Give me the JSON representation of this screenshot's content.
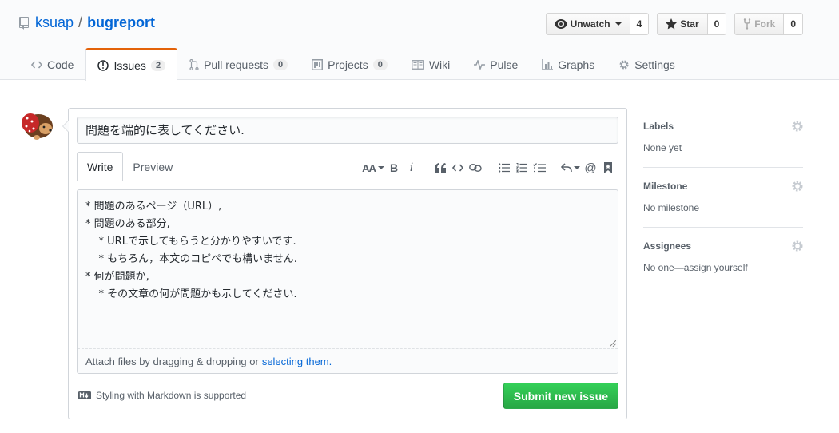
{
  "repo": {
    "owner": "ksuap",
    "separator": "/",
    "name": "bugreport"
  },
  "actions": {
    "watch": {
      "label": "Unwatch",
      "count": "4"
    },
    "star": {
      "label": "Star",
      "count": "0"
    },
    "fork": {
      "label": "Fork",
      "count": "0"
    }
  },
  "tabs": [
    {
      "label": "Code"
    },
    {
      "label": "Issues",
      "count": "2",
      "selected": true
    },
    {
      "label": "Pull requests",
      "count": "0"
    },
    {
      "label": "Projects",
      "count": "0"
    },
    {
      "label": "Wiki"
    },
    {
      "label": "Pulse"
    },
    {
      "label": "Graphs"
    },
    {
      "label": "Settings"
    }
  ],
  "issue_form": {
    "title_value": "問題を端的に表してください.",
    "editor_tabs": {
      "write": "Write",
      "preview": "Preview"
    },
    "toolbar": {
      "text_size": "AA",
      "bold": "B",
      "italic": "i"
    },
    "body_value": "* 問題のあるページ（URL）,\n* 問題のある部分,\n    * URLで示してもらうと分かりやすいです.\n    * もちろん，本文のコピペでも構いません.\n* 何が問題か,\n    * その文章の何が問題かも示してください.",
    "attach_text": "Attach files by dragging & dropping or",
    "attach_link": "selecting them.",
    "markdown_note": "Styling with Markdown is supported",
    "submit_label": "Submit new issue"
  },
  "sidebar": {
    "labels": {
      "heading": "Labels",
      "value": "None yet"
    },
    "milestone": {
      "heading": "Milestone",
      "value": "No milestone"
    },
    "assignees": {
      "heading": "Assignees",
      "value": "No one—assign yourself"
    }
  },
  "colors": {
    "link": "#0366d6",
    "accent_tab": "#e36209",
    "submit": "#28a745"
  }
}
